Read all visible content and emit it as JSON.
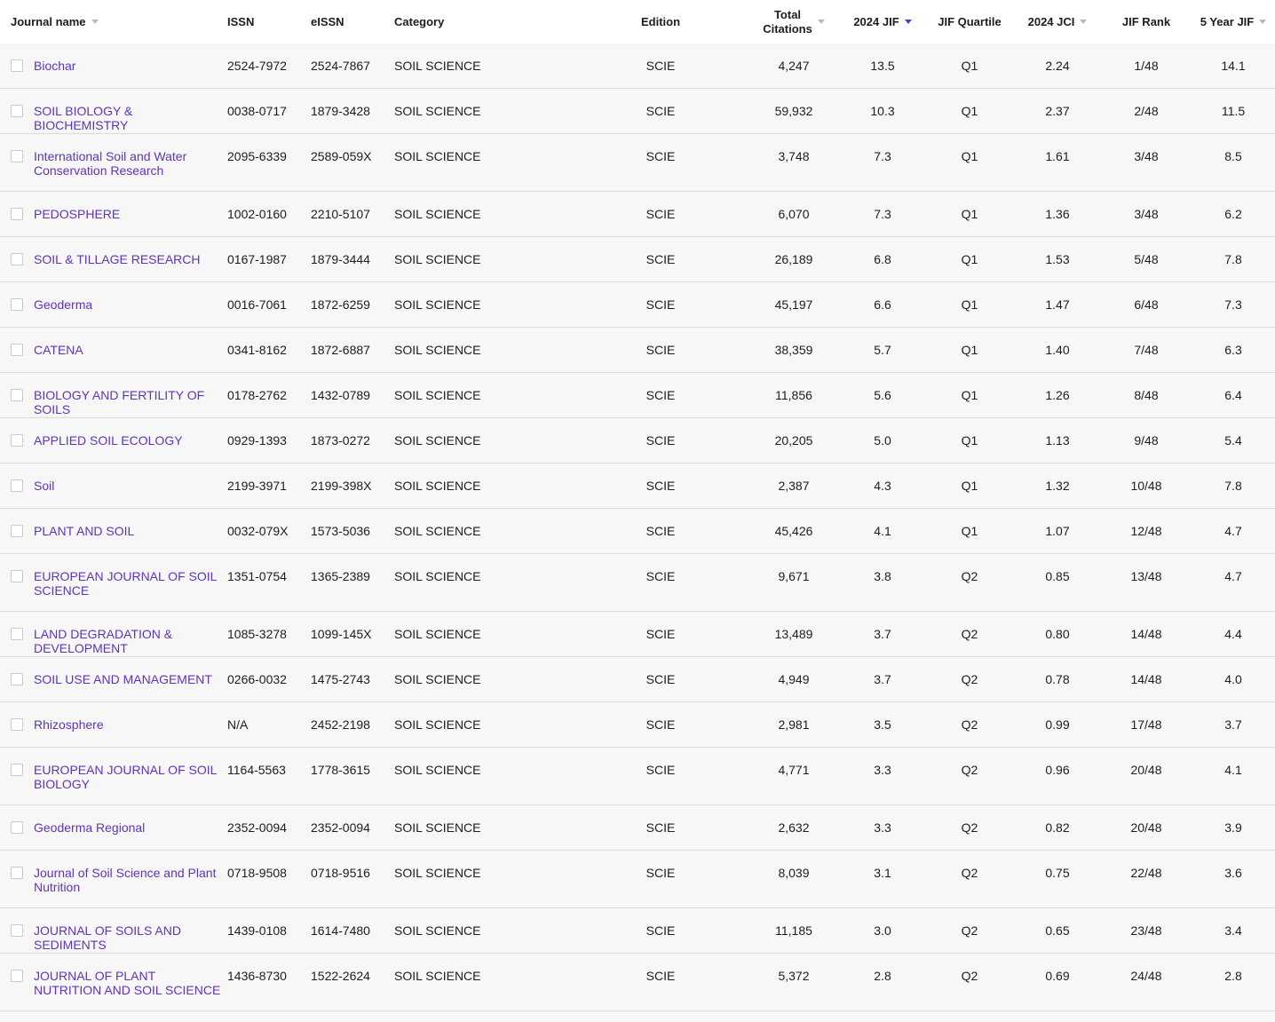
{
  "accent_color": "#5e33bf",
  "headers": {
    "journal": "Journal name",
    "issn": "ISSN",
    "eissn": "eISSN",
    "category": "Category",
    "edition": "Edition",
    "citations_line1": "Total",
    "citations_line2": "Citations",
    "jif": "2024 JIF",
    "quartile": "JIF Quartile",
    "jci": "2024 JCI",
    "rank": "JIF Rank",
    "five_year": "5 Year JIF"
  },
  "rows": [
    {
      "name": "Biochar",
      "issn": "2524-7972",
      "eissn": "2524-7867",
      "category": "SOIL SCIENCE",
      "edition": "SCIE",
      "citations": "4,247",
      "jif": "13.5",
      "quartile": "Q1",
      "jci": "2.24",
      "rank": "1/48",
      "five_year": "14.1"
    },
    {
      "name": "SOIL BIOLOGY & BIOCHEMISTRY",
      "issn": "0038-0717",
      "eissn": "1879-3428",
      "category": "SOIL SCIENCE",
      "edition": "SCIE",
      "citations": "59,932",
      "jif": "10.3",
      "quartile": "Q1",
      "jci": "2.37",
      "rank": "2/48",
      "five_year": "11.5"
    },
    {
      "name": "International Soil and Water Conservation Research",
      "issn": "2095-6339",
      "eissn": "2589-059X",
      "category": "SOIL SCIENCE",
      "edition": "SCIE",
      "citations": "3,748",
      "jif": "7.3",
      "quartile": "Q1",
      "jci": "1.61",
      "rank": "3/48",
      "five_year": "8.5"
    },
    {
      "name": "PEDOSPHERE",
      "issn": "1002-0160",
      "eissn": "2210-5107",
      "category": "SOIL SCIENCE",
      "edition": "SCIE",
      "citations": "6,070",
      "jif": "7.3",
      "quartile": "Q1",
      "jci": "1.36",
      "rank": "3/48",
      "five_year": "6.2"
    },
    {
      "name": "SOIL & TILLAGE RESEARCH",
      "issn": "0167-1987",
      "eissn": "1879-3444",
      "category": "SOIL SCIENCE",
      "edition": "SCIE",
      "citations": "26,189",
      "jif": "6.8",
      "quartile": "Q1",
      "jci": "1.53",
      "rank": "5/48",
      "five_year": "7.8"
    },
    {
      "name": "Geoderma",
      "issn": "0016-7061",
      "eissn": "1872-6259",
      "category": "SOIL SCIENCE",
      "edition": "SCIE",
      "citations": "45,197",
      "jif": "6.6",
      "quartile": "Q1",
      "jci": "1.47",
      "rank": "6/48",
      "five_year": "7.3"
    },
    {
      "name": "CATENA",
      "issn": "0341-8162",
      "eissn": "1872-6887",
      "category": "SOIL SCIENCE",
      "edition": "SCIE",
      "citations": "38,359",
      "jif": "5.7",
      "quartile": "Q1",
      "jci": "1.40",
      "rank": "7/48",
      "five_year": "6.3"
    },
    {
      "name": "BIOLOGY AND FERTILITY OF SOILS",
      "issn": "0178-2762",
      "eissn": "1432-0789",
      "category": "SOIL SCIENCE",
      "edition": "SCIE",
      "citations": "11,856",
      "jif": "5.6",
      "quartile": "Q1",
      "jci": "1.26",
      "rank": "8/48",
      "five_year": "6.4"
    },
    {
      "name": "APPLIED SOIL ECOLOGY",
      "issn": "0929-1393",
      "eissn": "1873-0272",
      "category": "SOIL SCIENCE",
      "edition": "SCIE",
      "citations": "20,205",
      "jif": "5.0",
      "quartile": "Q1",
      "jci": "1.13",
      "rank": "9/48",
      "five_year": "5.4"
    },
    {
      "name": "Soil",
      "issn": "2199-3971",
      "eissn": "2199-398X",
      "category": "SOIL SCIENCE",
      "edition": "SCIE",
      "citations": "2,387",
      "jif": "4.3",
      "quartile": "Q1",
      "jci": "1.32",
      "rank": "10/48",
      "five_year": "7.8"
    },
    {
      "name": "PLANT AND SOIL",
      "issn": "0032-079X",
      "eissn": "1573-5036",
      "category": "SOIL SCIENCE",
      "edition": "SCIE",
      "citations": "45,426",
      "jif": "4.1",
      "quartile": "Q1",
      "jci": "1.07",
      "rank": "12/48",
      "five_year": "4.7"
    },
    {
      "name": "EUROPEAN JOURNAL OF SOIL SCIENCE",
      "issn": "1351-0754",
      "eissn": "1365-2389",
      "category": "SOIL SCIENCE",
      "edition": "SCIE",
      "citations": "9,671",
      "jif": "3.8",
      "quartile": "Q2",
      "jci": "0.85",
      "rank": "13/48",
      "five_year": "4.7"
    },
    {
      "name": "LAND DEGRADATION & DEVELOPMENT",
      "issn": "1085-3278",
      "eissn": "1099-145X",
      "category": "SOIL SCIENCE",
      "edition": "SCIE",
      "citations": "13,489",
      "jif": "3.7",
      "quartile": "Q2",
      "jci": "0.80",
      "rank": "14/48",
      "five_year": "4.4"
    },
    {
      "name": "SOIL USE AND MANAGEMENT",
      "issn": "0266-0032",
      "eissn": "1475-2743",
      "category": "SOIL SCIENCE",
      "edition": "SCIE",
      "citations": "4,949",
      "jif": "3.7",
      "quartile": "Q2",
      "jci": "0.78",
      "rank": "14/48",
      "five_year": "4.0"
    },
    {
      "name": "Rhizosphere",
      "issn": "N/A",
      "eissn": "2452-2198",
      "category": "SOIL SCIENCE",
      "edition": "SCIE",
      "citations": "2,981",
      "jif": "3.5",
      "quartile": "Q2",
      "jci": "0.99",
      "rank": "17/48",
      "five_year": "3.7"
    },
    {
      "name": "EUROPEAN JOURNAL OF SOIL BIOLOGY",
      "issn": "1164-5563",
      "eissn": "1778-3615",
      "category": "SOIL SCIENCE",
      "edition": "SCIE",
      "citations": "4,771",
      "jif": "3.3",
      "quartile": "Q2",
      "jci": "0.96",
      "rank": "20/48",
      "five_year": "4.1"
    },
    {
      "name": "Geoderma Regional",
      "issn": "2352-0094",
      "eissn": "2352-0094",
      "category": "SOIL SCIENCE",
      "edition": "SCIE",
      "citations": "2,632",
      "jif": "3.3",
      "quartile": "Q2",
      "jci": "0.82",
      "rank": "20/48",
      "five_year": "3.9"
    },
    {
      "name": "Journal of Soil Science and Plant Nutrition",
      "issn": "0718-9508",
      "eissn": "0718-9516",
      "category": "SOIL SCIENCE",
      "edition": "SCIE",
      "citations": "8,039",
      "jif": "3.1",
      "quartile": "Q2",
      "jci": "0.75",
      "rank": "22/48",
      "five_year": "3.6"
    },
    {
      "name": "JOURNAL OF SOILS AND SEDIMENTS",
      "issn": "1439-0108",
      "eissn": "1614-7480",
      "category": "SOIL SCIENCE",
      "edition": "SCIE",
      "citations": "11,185",
      "jif": "3.0",
      "quartile": "Q2",
      "jci": "0.65",
      "rank": "23/48",
      "five_year": "3.4"
    },
    {
      "name": "JOURNAL OF PLANT NUTRITION AND SOIL SCIENCE",
      "issn": "1436-8730",
      "eissn": "1522-2624",
      "category": "SOIL SCIENCE",
      "edition": "SCIE",
      "citations": "5,372",
      "jif": "2.8",
      "quartile": "Q2",
      "jci": "0.69",
      "rank": "24/48",
      "five_year": "2.8"
    }
  ]
}
